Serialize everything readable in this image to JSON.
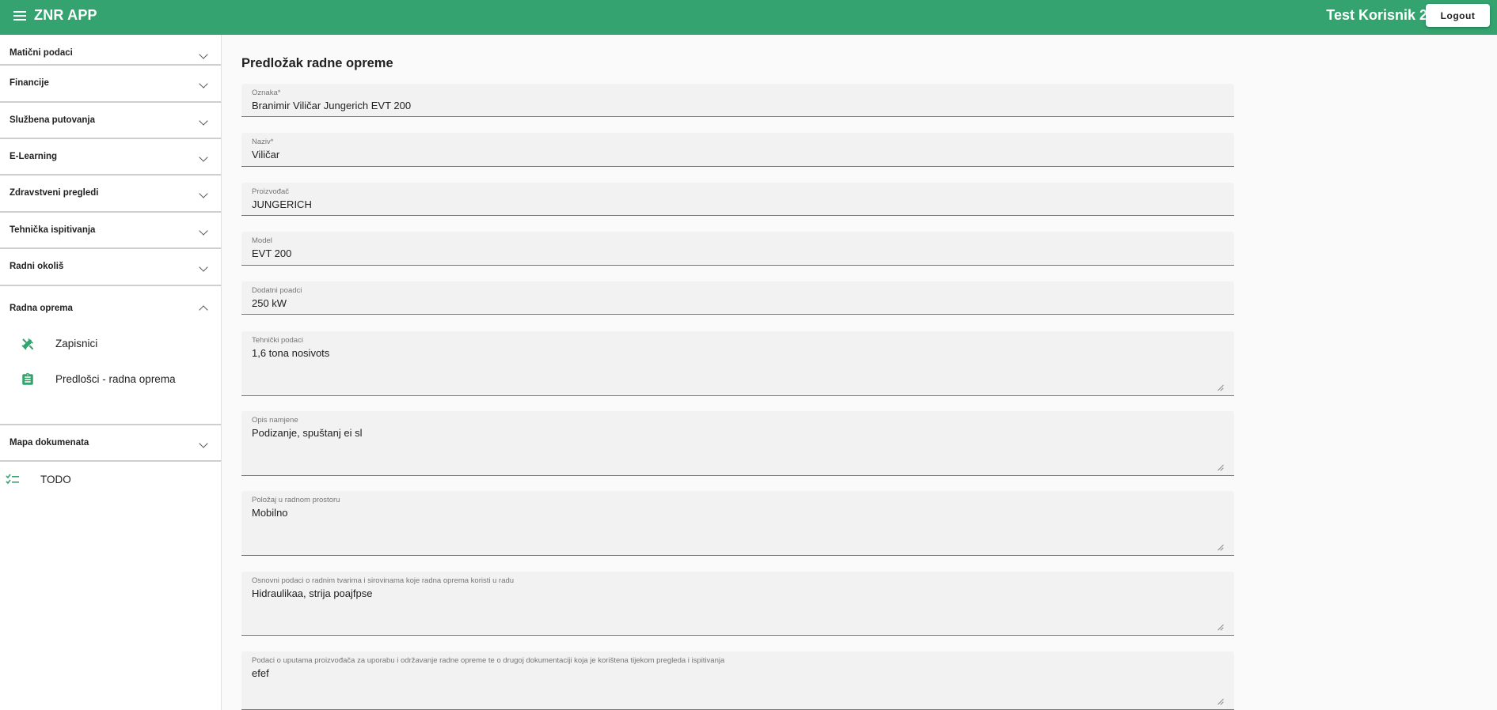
{
  "header": {
    "app_title": "ZNR APP",
    "user_name": "Test Korisnik 2",
    "logout_label": "Logout",
    "color": "#34a36f"
  },
  "sidebar": {
    "sections": [
      {
        "label": "Matični podaci",
        "expanded": false
      },
      {
        "label": "Financije",
        "expanded": false
      },
      {
        "label": "Službena putovanja",
        "expanded": false
      },
      {
        "label": "E-Learning",
        "expanded": false
      },
      {
        "label": "Zdravstveni pregledi",
        "expanded": false
      },
      {
        "label": "Tehnička ispitivanja",
        "expanded": false
      },
      {
        "label": "Radni okoliš",
        "expanded": false
      },
      {
        "label": "Radna oprema",
        "expanded": true
      },
      {
        "label": "Mapa dokumenata",
        "expanded": false
      }
    ],
    "radna_oprema_items": [
      {
        "label": "Zapisnici",
        "icon": "tools-icon"
      },
      {
        "label": "Predlošci - radna oprema",
        "icon": "clipboard-icon"
      }
    ],
    "todo": {
      "label": "TODO",
      "icon": "checklist-icon"
    }
  },
  "form": {
    "title": "Predložak radne opreme",
    "fields": [
      {
        "label": "Oznaka*",
        "value": "Branimir Viličar Jungerich EVT 200"
      },
      {
        "label": "Naziv*",
        "value": "Viličar"
      },
      {
        "label": "Proizvođač",
        "value": "JUNGERICH"
      },
      {
        "label": "Model",
        "value": "EVT 200"
      },
      {
        "label": "Dodatni poadci",
        "value": "250 kW"
      },
      {
        "label": "Tehnički podaci",
        "value": "1,6 tona nosivots"
      },
      {
        "label": "Opis namjene",
        "value": "Podizanje, spuštanj ei sl"
      },
      {
        "label": "Položaj u radnom prostoru",
        "value": "Mobilno"
      },
      {
        "label": "Osnovni podaci o radnim tvarima i sirovinama koje radna oprema koristi u radu",
        "value": "Hidraulikaa, strija poajfpse"
      },
      {
        "label": "Podaci o uputama proizvođača za uporabu i održavanje radne opreme te o drugoj dokumentaciji koja je korištena tijekom pregleda i ispitivanja",
        "value": "efef"
      }
    ]
  }
}
